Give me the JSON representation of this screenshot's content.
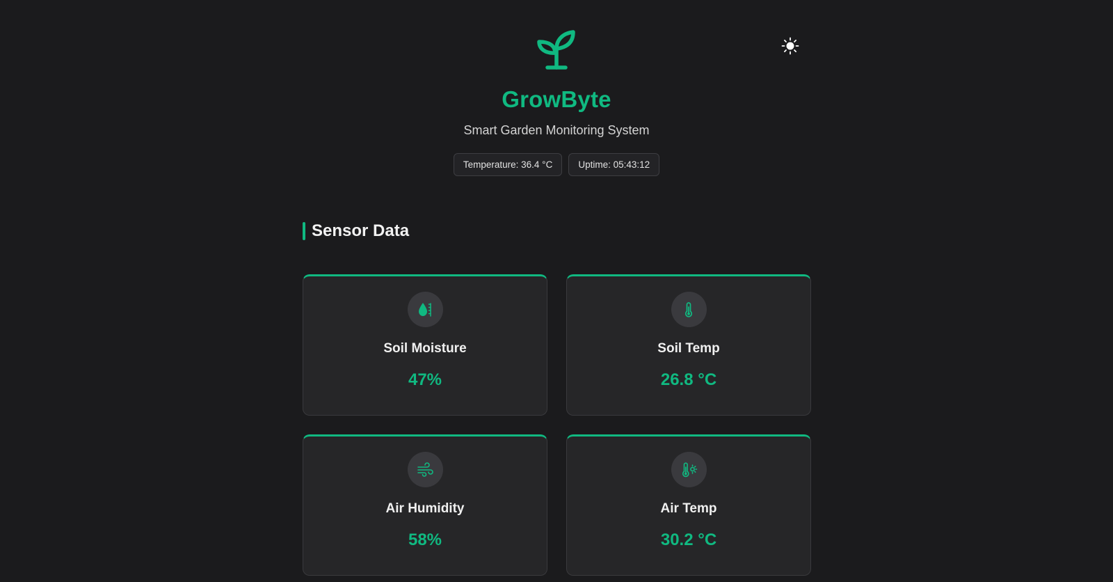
{
  "app": {
    "title": "GrowByte",
    "subtitle": "Smart Garden Monitoring System",
    "logo_icon": "seedling-icon",
    "accent_color": "#10b981"
  },
  "theme_toggle": {
    "icon": "sun-icon"
  },
  "status": {
    "temperature": "Temperature: 36.4 °C",
    "uptime": "Uptime: 05:43:12"
  },
  "section": {
    "title": "Sensor Data"
  },
  "sensors": [
    {
      "label": "Soil Moisture",
      "value": "47%",
      "icon": "droplet-gauge-icon"
    },
    {
      "label": "Soil Temp",
      "value": "26.8 °C",
      "icon": "thermometer-icon"
    },
    {
      "label": "Air Humidity",
      "value": "58%",
      "icon": "wind-icon"
    },
    {
      "label": "Air Temp",
      "value": "30.2 °C",
      "icon": "thermometer-sun-icon"
    }
  ]
}
